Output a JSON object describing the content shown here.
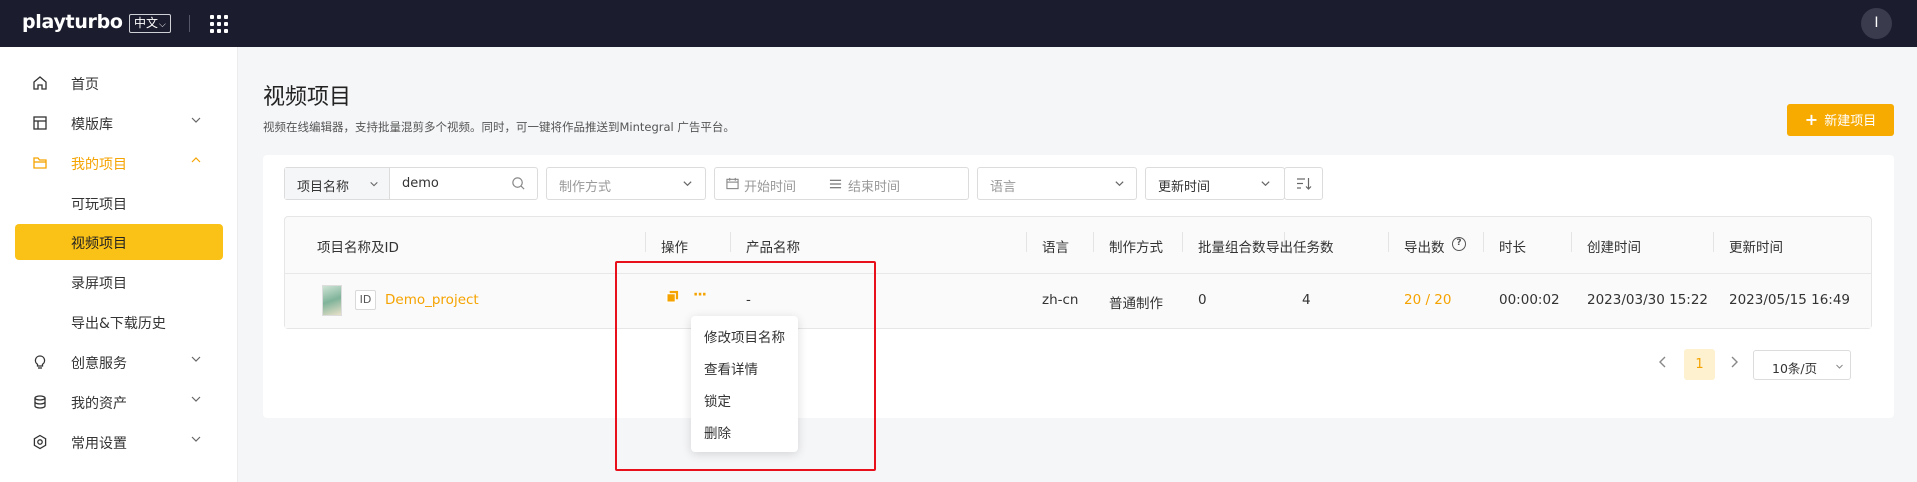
{
  "topbar": {
    "logo_main": "playturbo",
    "lang": "中文",
    "avatar_initial": "I"
  },
  "sidebar": {
    "items": [
      {
        "label": "首页",
        "icon": "home-icon"
      },
      {
        "label": "模版库",
        "icon": "template-icon"
      },
      {
        "label": "我的项目",
        "icon": "folder-icon"
      },
      {
        "label": "可玩项目"
      },
      {
        "label": "视频项目"
      },
      {
        "label": "录屏项目"
      },
      {
        "label": "导出&下载历史"
      },
      {
        "label": "创意服务",
        "icon": "lightbulb-icon"
      },
      {
        "label": "我的资产",
        "icon": "database-icon"
      },
      {
        "label": "常用设置",
        "icon": "settings-icon"
      }
    ]
  },
  "page": {
    "title": "视频项目",
    "description": "视频在线编辑器，支持批量混剪多个视频。同时，可一键将作品推送到Mintegral 广告平台。",
    "new_button": "新建项目"
  },
  "filters": {
    "name_prefix": "项目名称",
    "name_value": "demo",
    "method_placeholder": "制作方式",
    "start_placeholder": "开始时间",
    "end_placeholder": "结束时间",
    "language_placeholder": "语言",
    "sort_value": "更新时间"
  },
  "table": {
    "headers": [
      "项目名称及ID",
      "操作",
      "产品名称",
      "语言",
      "制作方式",
      "批量组合数",
      "导出任务数",
      "导出数",
      "时长",
      "创建时间",
      "更新时间"
    ],
    "row": {
      "id_tag": "ID",
      "name": "Demo_project",
      "more": "···",
      "product": "-",
      "language": "zh-cn",
      "method": "普通制作",
      "batch": "0",
      "tasks": "4",
      "exports": "20 / 20",
      "duration": "00:00:02",
      "created": "2023/03/30 15:22",
      "updated": "2023/05/15 16:49"
    }
  },
  "menu": {
    "items": [
      "修改项目名称",
      "查看详情",
      "锁定",
      "删除"
    ]
  },
  "pagination": {
    "current": "1",
    "page_size": "10条/页"
  },
  "colors": {
    "accent": "#f7aa00",
    "topbar": "#1b1c2e",
    "highlight": "#e8101b"
  }
}
